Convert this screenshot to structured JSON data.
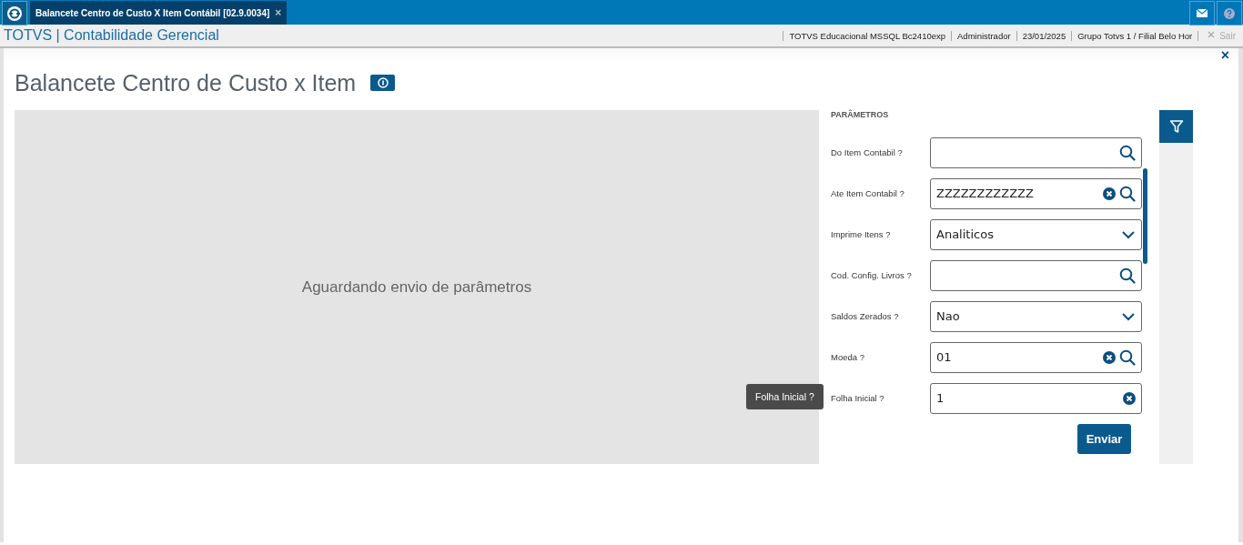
{
  "tab": {
    "title": "Balancete Centro de Custo X Item Contábil [02.9.0034]",
    "close": "×"
  },
  "app_bar": {
    "title": "TOTVS | Contabilidade Gerencial",
    "info": [
      "TOTVS Educacional MSSQL Bc2410exp",
      "Administrador",
      "23/01/2025",
      "Grupo Totvs 1 / Filial Belo Hor"
    ],
    "exit": "Sair"
  },
  "page": {
    "title": "Balancete Centro de Custo x Item",
    "close": "×"
  },
  "preview": {
    "message": "Aguardando envio de parâmetros"
  },
  "parameters": {
    "heading": "PARÂMETROS",
    "fields": [
      {
        "label": "Do Item Contabil ?",
        "kind": "lookup",
        "clearable": false
      },
      {
        "label": "Ate Item Contabil ?",
        "kind": "lookup",
        "value": "ZZZZZZZZZZZZ",
        "clearable": true
      },
      {
        "label": "Imprime Itens ?",
        "kind": "select",
        "value": "Analiticos",
        "clearable": false
      },
      {
        "label": "Cod. Config. Livros ?",
        "kind": "lookup",
        "clearable": false
      },
      {
        "label": "Saldos Zerados ?",
        "kind": "select",
        "value": "Nao",
        "clearable": false
      },
      {
        "label": "Moeda ?",
        "kind": "lookup",
        "value": "01",
        "clearable": true
      },
      {
        "label": "Folha Inicial ?",
        "kind": "text",
        "value": "1",
        "clearable": true
      }
    ],
    "tooltip": "Folha Inicial ?",
    "submit": "Enviar"
  }
}
